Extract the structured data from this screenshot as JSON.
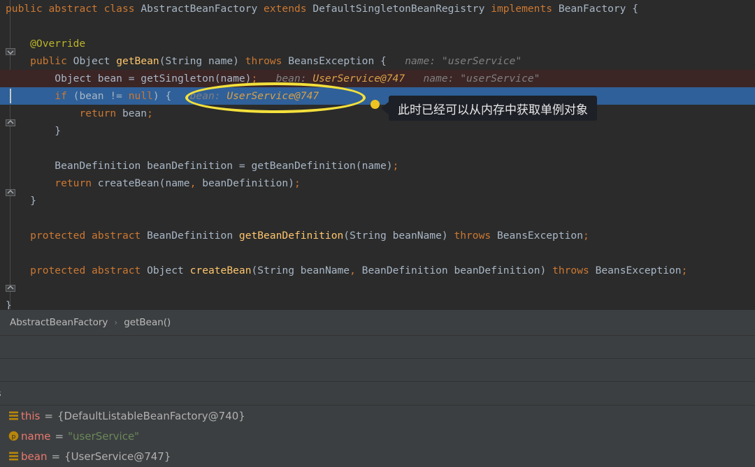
{
  "editor": {
    "lines": [
      {
        "id": "l1",
        "state": "normal",
        "tokens": [
          {
            "t": "public ",
            "c": "k"
          },
          {
            "t": "abstract ",
            "c": "k"
          },
          {
            "t": "class ",
            "c": "k"
          },
          {
            "t": "AbstractBeanFactory ",
            "c": "t"
          },
          {
            "t": "extends ",
            "c": "k"
          },
          {
            "t": "DefaultSingletonBeanRegistry ",
            "c": "t"
          },
          {
            "t": "implements ",
            "c": "k"
          },
          {
            "t": "BeanFactory ",
            "c": "t"
          },
          {
            "t": "{",
            "c": "p"
          }
        ]
      },
      {
        "id": "l2",
        "state": "normal",
        "tokens": []
      },
      {
        "id": "l3",
        "state": "normal",
        "tokens": [
          {
            "t": "    @Override",
            "c": "an"
          }
        ]
      },
      {
        "id": "l4",
        "state": "normal",
        "tokens": [
          {
            "t": "    ",
            "c": "p"
          },
          {
            "t": "public ",
            "c": "k"
          },
          {
            "t": "Object ",
            "c": "t"
          },
          {
            "t": "getBean",
            "c": "m"
          },
          {
            "t": "(",
            "c": "p"
          },
          {
            "t": "String",
            "c": "t"
          },
          {
            "t": " name) ",
            "c": "t"
          },
          {
            "t": "throws ",
            "c": "k"
          },
          {
            "t": "BeansException",
            "c": "t"
          },
          {
            "t": " {",
            "c": "p"
          },
          {
            "t": "   name: ",
            "c": "hint"
          },
          {
            "t": "\"userService\"",
            "c": "hint"
          }
        ]
      },
      {
        "id": "l5",
        "state": "exec",
        "tokens": [
          {
            "t": "        Object bean = getSingleton(name)",
            "c": "t"
          },
          {
            "t": ";",
            "c": "sc"
          },
          {
            "t": "   bean: ",
            "c": "hint"
          },
          {
            "t": "UserService@747",
            "c": "hv"
          },
          {
            "t": "   name: ",
            "c": "hint"
          },
          {
            "t": "\"userService\"",
            "c": "hint"
          }
        ]
      },
      {
        "id": "l6",
        "state": "sel",
        "tokens": [
          {
            "t": "        ",
            "c": "p"
          },
          {
            "t": "if",
            "c": "k"
          },
          {
            "t": " (bean ",
            "c": "t"
          },
          {
            "t": "!=",
            "c": "p"
          },
          {
            "t": " ",
            "c": "t"
          },
          {
            "t": "null",
            "c": "k"
          },
          {
            "t": ") {",
            "c": "p"
          },
          {
            "t": "   bean: ",
            "c": "hint"
          },
          {
            "t": "UserService@747",
            "c": "hv"
          }
        ]
      },
      {
        "id": "l7",
        "state": "normal",
        "tokens": [
          {
            "t": "            ",
            "c": "p"
          },
          {
            "t": "return",
            "c": "k"
          },
          {
            "t": " bean",
            "c": "t"
          },
          {
            "t": ";",
            "c": "sc"
          }
        ]
      },
      {
        "id": "l8",
        "state": "normal",
        "tokens": [
          {
            "t": "        }",
            "c": "p"
          }
        ]
      },
      {
        "id": "l9",
        "state": "normal",
        "tokens": []
      },
      {
        "id": "l10",
        "state": "normal",
        "tokens": [
          {
            "t": "        BeanDefinition beanDefinition = getBeanDefinition(name)",
            "c": "t"
          },
          {
            "t": ";",
            "c": "sc"
          }
        ]
      },
      {
        "id": "l11",
        "state": "normal",
        "tokens": [
          {
            "t": "        ",
            "c": "p"
          },
          {
            "t": "return",
            "c": "k"
          },
          {
            "t": " createBean(name",
            "c": "t"
          },
          {
            "t": ",",
            "c": "sc"
          },
          {
            "t": " beanDefinition)",
            "c": "t"
          },
          {
            "t": ";",
            "c": "sc"
          }
        ]
      },
      {
        "id": "l12",
        "state": "normal",
        "tokens": [
          {
            "t": "    }",
            "c": "p"
          }
        ]
      },
      {
        "id": "l13",
        "state": "normal",
        "tokens": []
      },
      {
        "id": "l14",
        "state": "normal",
        "tokens": [
          {
            "t": "    ",
            "c": "p"
          },
          {
            "t": "protected ",
            "c": "k"
          },
          {
            "t": "abstract ",
            "c": "k"
          },
          {
            "t": "BeanDefinition ",
            "c": "t"
          },
          {
            "t": "getBeanDefinition",
            "c": "m"
          },
          {
            "t": "(",
            "c": "p"
          },
          {
            "t": "String beanName) ",
            "c": "t"
          },
          {
            "t": "throws ",
            "c": "k"
          },
          {
            "t": "BeansException",
            "c": "t"
          },
          {
            "t": ";",
            "c": "sc"
          }
        ]
      },
      {
        "id": "l15",
        "state": "normal",
        "tokens": []
      },
      {
        "id": "l16",
        "state": "normal",
        "tokens": [
          {
            "t": "    ",
            "c": "p"
          },
          {
            "t": "protected ",
            "c": "k"
          },
          {
            "t": "abstract ",
            "c": "k"
          },
          {
            "t": "Object ",
            "c": "t"
          },
          {
            "t": "createBean",
            "c": "m"
          },
          {
            "t": "(",
            "c": "p"
          },
          {
            "t": "String beanName",
            "c": "t"
          },
          {
            "t": ",",
            "c": "sc"
          },
          {
            "t": " BeanDefinition beanDefinition) ",
            "c": "t"
          },
          {
            "t": "throws ",
            "c": "k"
          },
          {
            "t": "BeansException",
            "c": "t"
          },
          {
            "t": ";",
            "c": "sc"
          }
        ]
      },
      {
        "id": "l17",
        "state": "normal",
        "tokens": []
      },
      {
        "id": "l18",
        "state": "normal",
        "tokens": [
          {
            "t": "}",
            "c": "p"
          }
        ]
      }
    ]
  },
  "annotation": {
    "callout_text": "此时已经可以从内存中获取单例对象",
    "ellipse_color": "#f3e03c",
    "dot_color": "#f0c420",
    "callout_bg": "#1d2026"
  },
  "breadcrumb": {
    "class_name": "AbstractBeanFactory",
    "separator": "›",
    "method_name": "getBean()"
  },
  "variables": {
    "panel_title": "bles",
    "rows": [
      {
        "icon": "object-icon",
        "name": "this",
        "eq": "=",
        "value": "{DefaultListableBeanFactory@740}",
        "kind": "obj"
      },
      {
        "icon": "parameter-icon",
        "name": "name",
        "eq": "=",
        "value": "\"userService\"",
        "kind": "str"
      },
      {
        "icon": "object-icon",
        "name": "bean",
        "eq": "=",
        "value": "{UserService@747}",
        "kind": "obj"
      }
    ]
  },
  "colors": {
    "editor_bg": "#2b2b2b",
    "panel_bg": "#3c3f41",
    "selection_blue": "#2f6099",
    "exec_line_red": "#3b2525",
    "keyword_orange": "#cc7832",
    "method_yellow": "#ffc66d",
    "annotation_olive": "#bbb529",
    "string_green": "#6a8759",
    "var_name_red": "#e8796e",
    "icon_gold": "#b8860b"
  }
}
